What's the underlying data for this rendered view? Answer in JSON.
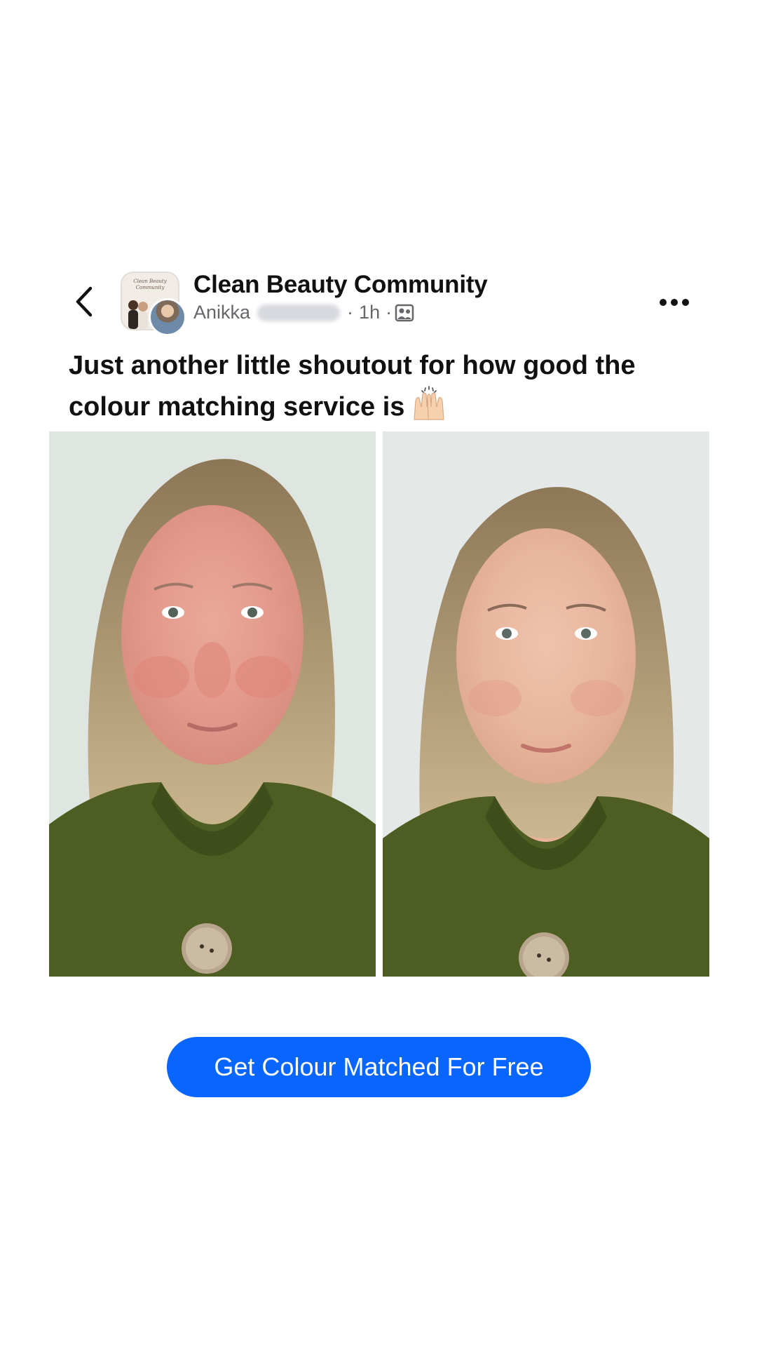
{
  "header": {
    "back_icon": "chevron-left-icon",
    "group_avatar_text": "Clean Beauty Community",
    "group_name": "Clean Beauty Community",
    "author_first_name": "Anikka",
    "time_ago": "1h",
    "separator": "·",
    "privacy_icon": "group-members-icon",
    "more_icon": "ellipsis-icon"
  },
  "post": {
    "text": "Just another little shoutout for how good the colour matching service is",
    "emoji_icon": "raising-hands-icon"
  },
  "photos": [
    {
      "caption": "",
      "state": "before"
    },
    {
      "caption": "",
      "state": "after"
    }
  ],
  "cta": {
    "label": "Get Colour Matched For Free",
    "color": "#0866ff"
  },
  "colors": {
    "primary_text": "#111111",
    "secondary_text": "#65676b",
    "accent": "#0866ff"
  }
}
